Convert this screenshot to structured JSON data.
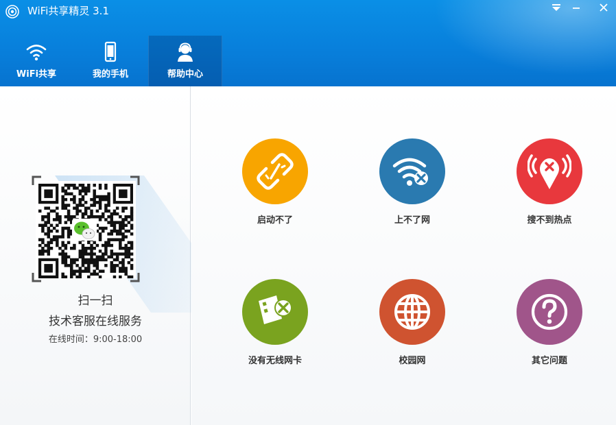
{
  "app": {
    "title": "WiFi共享精灵 3.1"
  },
  "nav": {
    "tabs": [
      {
        "label": "WiFi共享",
        "icon": "wifi-icon"
      },
      {
        "label": "我的手机",
        "icon": "phone-icon"
      },
      {
        "label": "帮助中心",
        "icon": "support-agent-icon",
        "active": true
      }
    ]
  },
  "support": {
    "scan": "扫一扫",
    "service": "技术客服在线服务",
    "hours": "在线时间：9:00-18:00"
  },
  "help_items": [
    {
      "label": "启动不了",
      "icon": "broken-link-icon",
      "color": "#f8a500"
    },
    {
      "label": "上不了网",
      "icon": "wifi-error-icon",
      "color": "#2a7ab0"
    },
    {
      "label": "搜不到热点",
      "icon": "hotspot-error-icon",
      "color": "#e8383d"
    },
    {
      "label": "没有无线网卡",
      "icon": "wireless-card-error-icon",
      "color": "#7aa31f"
    },
    {
      "label": "校园网",
      "icon": "globe-icon",
      "color": "#cf5330"
    },
    {
      "label": "其它问题",
      "icon": "question-icon",
      "color": "#a0558a"
    }
  ]
}
